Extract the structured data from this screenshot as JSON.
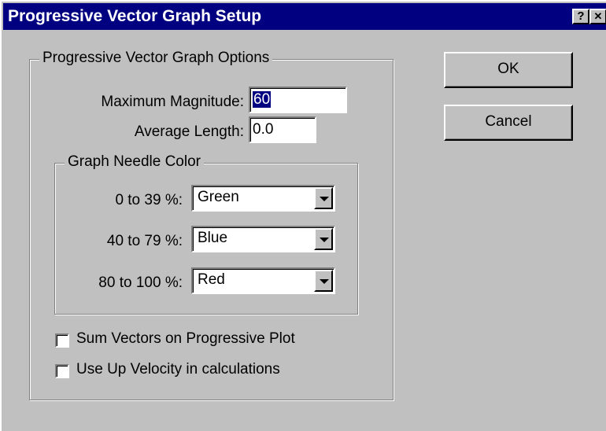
{
  "window": {
    "title": "Progressive Vector Graph Setup",
    "help_label": "?",
    "close_label": "✕"
  },
  "options_group": {
    "label": "Progressive Vector Graph Options",
    "max_magnitude_label": "Maximum Magnitude:",
    "max_magnitude_value": "60",
    "average_length_label": "Average Length:",
    "average_length_value": "0.0"
  },
  "needle_color_group": {
    "label": "Graph Needle Color",
    "rows": [
      {
        "label": "0 to 39 %:",
        "value": "Green"
      },
      {
        "label": "40 to 79 %:",
        "value": "Blue"
      },
      {
        "label": "80 to 100 %:",
        "value": "Red"
      }
    ]
  },
  "checkboxes": [
    {
      "label": "Sum Vectors on Progressive Plot",
      "checked": false
    },
    {
      "label": "Use Up Velocity in calculations",
      "checked": false
    }
  ],
  "buttons": {
    "ok_label": "OK",
    "cancel_label": "Cancel"
  }
}
